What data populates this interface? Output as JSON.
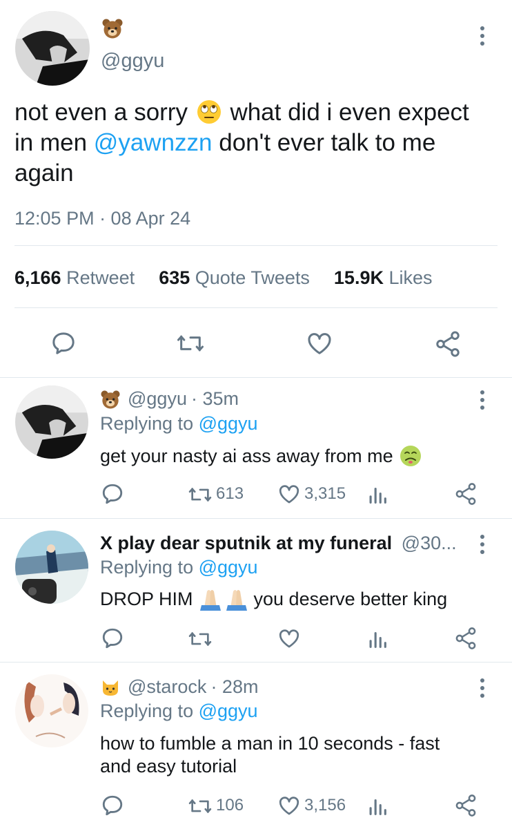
{
  "main_tweet": {
    "emoji_name": "bear-emoji",
    "handle": "@ggyu",
    "text_before": "not even a sorry",
    "text_after_emoji": "what did i even expect",
    "line2_before": "in men",
    "mention": "@yawnzzn",
    "line2_after": "don't ever talk to me",
    "line3": "again",
    "timestamp": "12:05 PM · 08 Apr 24",
    "stats": {
      "retweets_count": "6,166",
      "retweets_label": "Retweet",
      "quotes_count": "635",
      "quotes_label": "Quote Tweets",
      "likes_count": "15.9K",
      "likes_label": "Likes"
    },
    "actions": [
      "reply-icon",
      "retweet-icon",
      "like-icon",
      "share-icon"
    ]
  },
  "replies": [
    {
      "handle": "@ggyu",
      "time": "· 35m",
      "replying_label": "Replying to",
      "replying_to": "@ggyu",
      "text": "get your nasty ai ass away from me",
      "retweets": "613",
      "likes": "3,315"
    },
    {
      "name": "X play dear sputnik at my funeral",
      "handle_truncated": "@30...",
      "replying_label": "Replying to",
      "replying_to": "@ggyu",
      "text_before": "DROP HIM",
      "text_after": "you deserve better king",
      "retweets": "",
      "likes": ""
    },
    {
      "handle": "@starock",
      "time": "· 28m",
      "replying_label": "Replying to",
      "replying_to": "@ggyu",
      "text_line1": "how to fumble a man in 10 seconds - fast",
      "text_line2": "and easy tutorial",
      "retweets": "106",
      "likes": "3,156"
    }
  ],
  "colors": {
    "link": "#1da1f2",
    "muted": "#657786",
    "text": "#14171a",
    "divider": "#e1e8ed"
  }
}
